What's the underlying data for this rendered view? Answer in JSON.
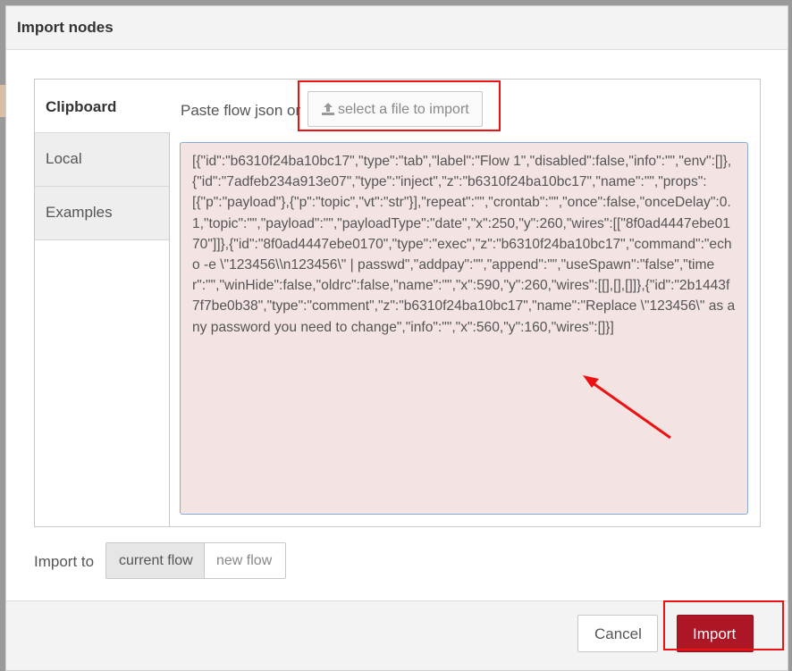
{
  "dialog": {
    "title": "Import nodes"
  },
  "tabs": [
    {
      "label": "Clipboard"
    },
    {
      "label": "Local"
    },
    {
      "label": "Examples"
    }
  ],
  "clipboard": {
    "paste_label": "Paste flow json or",
    "file_button_label": "select a file to import",
    "file_button_icon": "upload-icon",
    "json_text": "[{\"id\":\"b6310f24ba10bc17\",\"type\":\"tab\",\"label\":\"Flow 1\",\"disabled\":false,\"info\":\"\",\"env\":[]},{\"id\":\"7adfeb234a913e07\",\"type\":\"inject\",\"z\":\"b6310f24ba10bc17\",\"name\":\"\",\"props\":[{\"p\":\"payload\"},{\"p\":\"topic\",\"vt\":\"str\"}],\"repeat\":\"\",\"crontab\":\"\",\"once\":false,\"onceDelay\":0.1,\"topic\":\"\",\"payload\":\"\",\"payloadType\":\"date\",\"x\":250,\"y\":260,\"wires\":[[\"8f0ad4447ebe0170\"]]},{\"id\":\"8f0ad4447ebe0170\",\"type\":\"exec\",\"z\":\"b6310f24ba10bc17\",\"command\":\"echo -e \\\"123456\\\\n123456\\\" | passwd\",\"addpay\":\"\",\"append\":\"\",\"useSpawn\":\"false\",\"timer\":\"\",\"winHide\":false,\"oldrc\":false,\"name\":\"\",\"x\":590,\"y\":260,\"wires\":[[],[],[]]},{\"id\":\"2b1443f7f7be0b38\",\"type\":\"comment\",\"z\":\"b6310f24ba10bc17\",\"name\":\"Replace \\\"123456\\\" as any password you need to change\",\"info\":\"\",\"x\":560,\"y\":160,\"wires\":[]}]"
  },
  "import_to": {
    "label": "Import to",
    "options": [
      "current flow",
      "new flow"
    ],
    "selected": "current flow"
  },
  "footer": {
    "cancel_label": "Cancel",
    "import_label": "Import"
  },
  "colors": {
    "primary_button": "#ad1625",
    "json_background": "#f3e3e3",
    "highlight": "#ee1111"
  }
}
